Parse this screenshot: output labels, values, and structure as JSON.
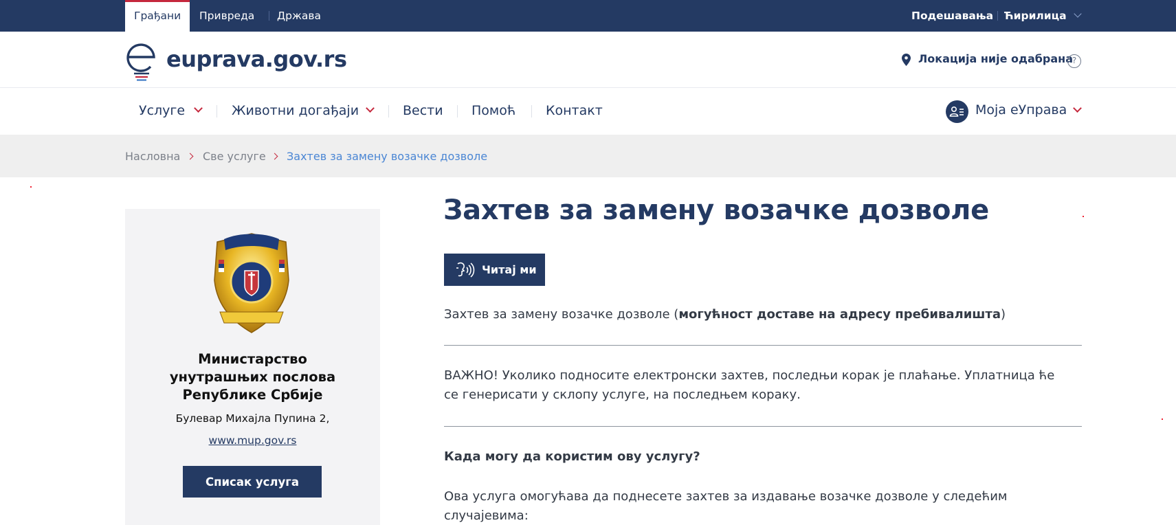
{
  "topbar": {
    "tabs": [
      "Грађани",
      "Привреда",
      "Држава"
    ],
    "settings": "Подешавања",
    "language": "Ћирилица"
  },
  "header": {
    "logo_text": "euprava.gov.rs",
    "location": "Локација није одабрана",
    "help": "?"
  },
  "nav": {
    "items": [
      "Услуге",
      "Животни догађаји",
      "Вести",
      "Помоћ",
      "Контакт"
    ],
    "account": "Моја еУправа"
  },
  "breadcrumb": [
    "Насловна",
    "Све услуге",
    "Захтев за замену возачке дозволе"
  ],
  "org": {
    "name_lines": [
      "Министарство",
      "унутрашњих послова",
      "Републике Србије"
    ],
    "address": "Булевар Михајла Пупина 2,",
    "website": "www.mup.gov.rs",
    "services_button": "Списак услуга"
  },
  "content": {
    "title": "Захтев за замену возачке дозволе",
    "read_button": "Читај ми",
    "intro_plain": "Захтев за замену возачке дозволе (",
    "intro_bold": "могућност доставе на адресу пребивалишта",
    "intro_end": ")",
    "important_line1": "ВАЖНО! Уколико подносите електронски захтев, последњи корак је плаћање. Уплатница ће",
    "important_line2": "се генерисати у склопу услуге, на последњем кораку.",
    "question": "Када могу да користим ову услугу?",
    "answer_line1": "Ова услуга омогућава да поднесете захтев за издавање возачке дозволе у следећим",
    "answer_line2": "случајевима:"
  },
  "colors": {
    "primary": "#243a63",
    "accent": "#c5283d",
    "link": "#4a86d4"
  }
}
